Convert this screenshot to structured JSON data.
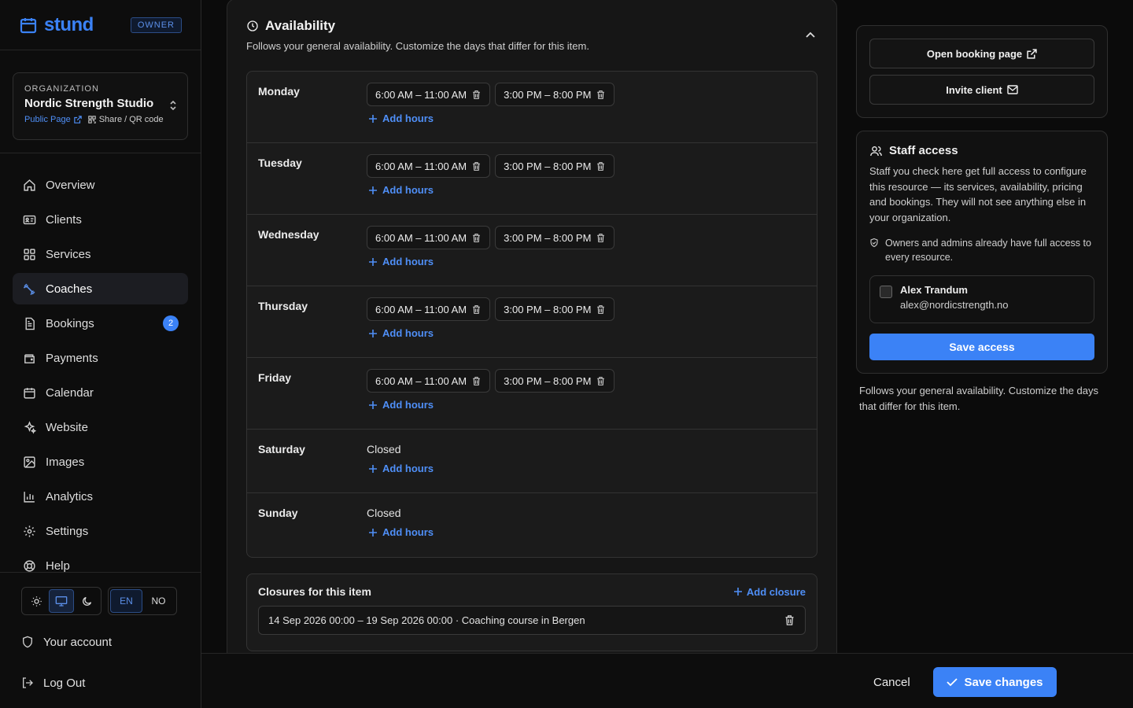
{
  "brand": {
    "name": "stund",
    "role": "OWNER"
  },
  "organization": {
    "label": "ORGANIZATION",
    "name": "Nordic Strength Studio",
    "public_page": "Public Page",
    "share": "Share / QR code"
  },
  "nav": {
    "overview": "Overview",
    "clients": "Clients",
    "services": "Services",
    "coaches": "Coaches",
    "bookings": "Bookings",
    "bookings_badge": "2",
    "payments": "Payments",
    "calendar": "Calendar",
    "website": "Website",
    "images": "Images",
    "analytics": "Analytics",
    "settings": "Settings",
    "help": "Help",
    "active": "Coaches"
  },
  "language": {
    "en": "EN",
    "no": "NO",
    "selected": "EN"
  },
  "theme": {
    "selected": "system"
  },
  "account": {
    "your_account": "Your account",
    "logout": "Log Out"
  },
  "availability": {
    "title": "Availability",
    "subtitle": "Follows your general availability. Customize the days that differ for this item.",
    "add_hours": "Add hours",
    "closed": "Closed",
    "days": [
      {
        "name": "Monday",
        "slots": [
          "6:00 AM – 11:00 AM",
          "3:00 PM – 8:00 PM"
        ]
      },
      {
        "name": "Tuesday",
        "slots": [
          "6:00 AM – 11:00 AM",
          "3:00 PM – 8:00 PM"
        ]
      },
      {
        "name": "Wednesday",
        "slots": [
          "6:00 AM – 11:00 AM",
          "3:00 PM – 8:00 PM"
        ]
      },
      {
        "name": "Thursday",
        "slots": [
          "6:00 AM – 11:00 AM",
          "3:00 PM – 8:00 PM"
        ]
      },
      {
        "name": "Friday",
        "slots": [
          "6:00 AM – 11:00 AM",
          "3:00 PM – 8:00 PM"
        ]
      },
      {
        "name": "Saturday",
        "slots": []
      },
      {
        "name": "Sunday",
        "slots": []
      }
    ]
  },
  "closures": {
    "title": "Closures for this item",
    "add_closure": "Add closure",
    "items": [
      "14 Sep 2026 00:00 – 19 Sep 2026 00:00 · Coaching course in Bergen"
    ]
  },
  "actions": {
    "open_booking_page": "Open booking page",
    "invite_client": "Invite client"
  },
  "staff_access": {
    "title": "Staff access",
    "description": "Staff you check here get full access to configure this resource — its services, availability, pricing and bookings. They will not see anything else in your organization.",
    "note": "Owners and admins already have full access to every resource.",
    "members": [
      {
        "name": "Alex Trandum",
        "email": "alex@nordicstrength.no",
        "checked": false
      }
    ],
    "save": "Save access"
  },
  "right_note": "Follows your general availability. Customize the days that differ for this item.",
  "footer": {
    "cancel": "Cancel",
    "save": "Save changes"
  },
  "colors": {
    "accent": "#3b82f6",
    "background": "#0b0b0b",
    "panel": "#161616"
  }
}
